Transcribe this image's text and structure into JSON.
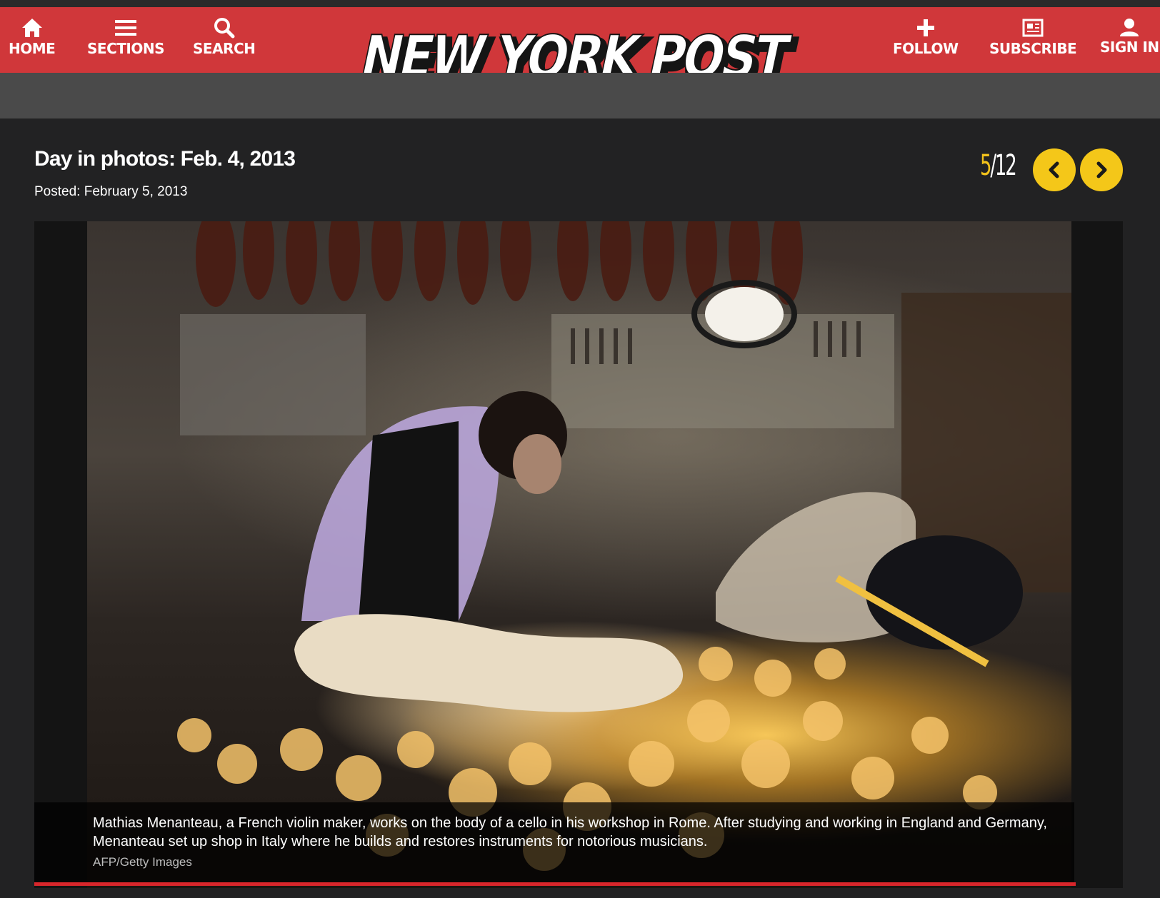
{
  "nav": {
    "home": "HOME",
    "sections": "SECTIONS",
    "search": "SEARCH",
    "follow": "FOLLOW",
    "subscribe": "SUBSCRIBE",
    "sign_in": "SIGN IN"
  },
  "logo": {
    "text": "NEW YORK POST"
  },
  "gallery": {
    "title": "Day in photos: Feb. 4, 2013",
    "posted": "Posted: February 5, 2013",
    "current": "5",
    "separator": "/",
    "total": "12"
  },
  "photo": {
    "caption": "Mathias Menanteau, a French violin maker, works on the body of a cello in his workshop in Rome. After studying and working in England and Germany, Menanteau set up shop in Italy where he builds and restores instruments for notorious musicians.",
    "credit": "AFP/Getty Images"
  },
  "colors": {
    "header_red": "#d0373a",
    "accent_yellow": "#f4c719",
    "background": "#222223"
  },
  "icons": [
    "home-icon",
    "menu-icon",
    "search-icon",
    "plus-icon",
    "newspaper-icon",
    "user-icon",
    "chevron-left-icon",
    "chevron-right-icon"
  ]
}
